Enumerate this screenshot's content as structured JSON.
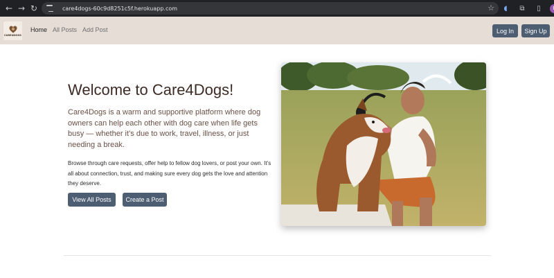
{
  "browser": {
    "url": "care4dogs-60c9d8251c5f.herokuapp.com",
    "profile_initial": "E",
    "icons": {
      "back": "arrow-left-icon",
      "forward": "arrow-right-icon",
      "reload": "reload-icon",
      "site_info": "tune-icon",
      "bookmark": "star-icon",
      "extension": "extension-icon",
      "puzzle": "puzzle-icon",
      "menu": "kebab-menu-icon"
    }
  },
  "navbar": {
    "logo_text": "CARE4DOGS",
    "links": [
      {
        "label": "Home",
        "active": true
      },
      {
        "label": "All Posts",
        "active": false
      },
      {
        "label": "Add Post",
        "active": false
      }
    ],
    "login_label": "Log In",
    "signup_label": "Sign Up"
  },
  "hero": {
    "title": "Welcome to Care4Dogs!",
    "lead": "Care4Dogs is a warm and supportive platform where dog owners can help each other with dog care when life gets busy — whether it’s due to work, travel, illness, or just needing a break.",
    "body": "Browse through care requests, offer help to fellow dog lovers, or post your own. It’s all about connection, trust, and making sure every dog gets the love and attention they deserve.",
    "view_button": "View All Posts",
    "create_button": "Create a Post",
    "image_subject": "man-with-headphones-hugging-dog-photo"
  },
  "colors": {
    "navbar_bg": "#e7ddd7",
    "button_bg": "#4d5e72",
    "title_color": "#3e2a24",
    "lead_color": "#6a4f45"
  }
}
